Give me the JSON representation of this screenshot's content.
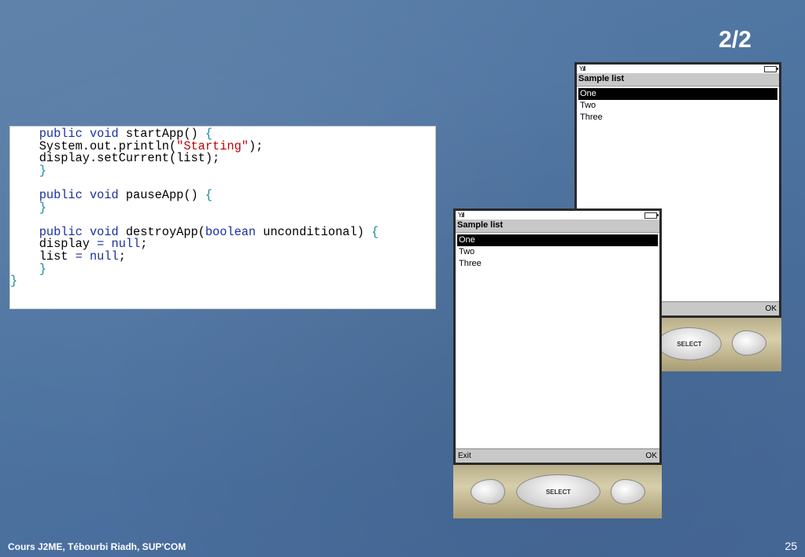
{
  "slide": {
    "page_label": "2/2",
    "footer_left": "Cours J2ME, Tébourbi Riadh, SUP'COM",
    "footer_page": "25"
  },
  "phone_back": {
    "title": "Sample list",
    "items": [
      "One",
      "Two",
      "Three"
    ],
    "soft_right": "OK",
    "select_label": "SELECT"
  },
  "phone_front": {
    "title": "Sample list",
    "items": [
      "One",
      "Two",
      "Three"
    ],
    "soft_left": "Exit",
    "soft_right": "OK",
    "select_label": "SELECT"
  }
}
